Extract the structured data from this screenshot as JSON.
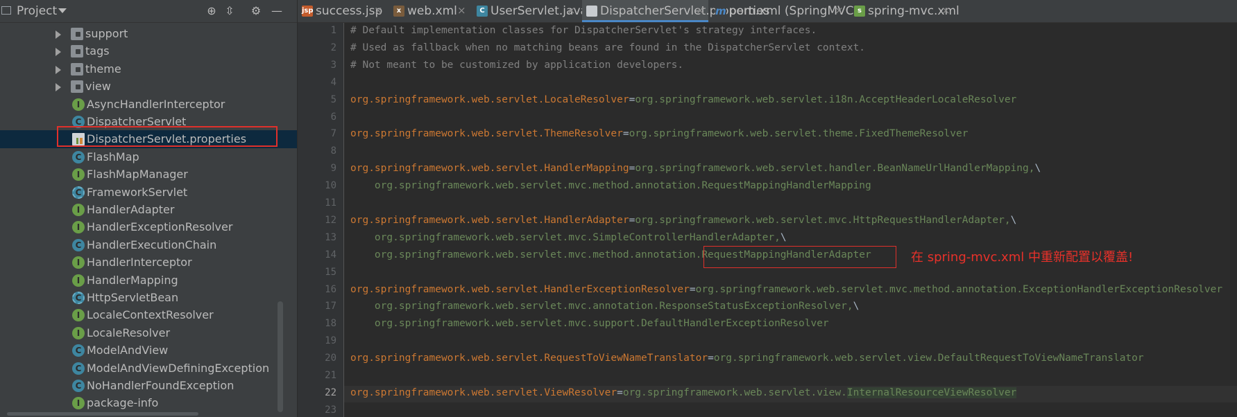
{
  "project_panel": {
    "title": "Project",
    "tree": [
      {
        "label": "support",
        "type": "folder"
      },
      {
        "label": "tags",
        "type": "folder"
      },
      {
        "label": "theme",
        "type": "folder"
      },
      {
        "label": "view",
        "type": "folder"
      },
      {
        "label": "AsyncHandlerInterceptor",
        "type": "interface"
      },
      {
        "label": "DispatcherServlet",
        "type": "class"
      },
      {
        "label": "DispatcherServlet.properties",
        "type": "properties",
        "selected": true
      },
      {
        "label": "FlashMap",
        "type": "class"
      },
      {
        "label": "FlashMapManager",
        "type": "interface"
      },
      {
        "label": "FrameworkServlet",
        "type": "abstract"
      },
      {
        "label": "HandlerAdapter",
        "type": "interface"
      },
      {
        "label": "HandlerExceptionResolver",
        "type": "interface"
      },
      {
        "label": "HandlerExecutionChain",
        "type": "class"
      },
      {
        "label": "HandlerInterceptor",
        "type": "interface"
      },
      {
        "label": "HandlerMapping",
        "type": "interface"
      },
      {
        "label": "HttpServletBean",
        "type": "abstract"
      },
      {
        "label": "LocaleContextResolver",
        "type": "interface"
      },
      {
        "label": "LocaleResolver",
        "type": "interface"
      },
      {
        "label": "ModelAndView",
        "type": "class"
      },
      {
        "label": "ModelAndViewDefiningException",
        "type": "class"
      },
      {
        "label": "NoHandlerFoundException",
        "type": "class"
      },
      {
        "label": "package-info",
        "type": "interface"
      }
    ]
  },
  "tabs": [
    {
      "label": "success.jsp",
      "icon": "jsp-file-icon",
      "icon_text": "jsp",
      "icon_color": "#c45c2c",
      "active": false
    },
    {
      "label": "web.xml",
      "icon": "xml-file-icon",
      "icon_text": "x",
      "icon_color": "#7a5c3c",
      "active": false
    },
    {
      "label": "UserServlet.java",
      "icon": "java-class-icon",
      "icon_text": "C",
      "icon_color": "#3e86a0",
      "active": false
    },
    {
      "label": "DispatcherServlet.properties",
      "icon": "properties-file-icon",
      "icon_text": "",
      "icon_color": "#c8ccd0",
      "active": true
    },
    {
      "label": "pom.xml (SpringMVC)",
      "icon": "maven-icon",
      "icon_text": "m",
      "icon_color": "#3c3f41",
      "active": false
    },
    {
      "label": "spring-mvc.xml",
      "icon": "spring-xml-icon",
      "icon_text": "s",
      "icon_color": "#6a9e48",
      "active": false
    }
  ],
  "editor": {
    "current_line": 22,
    "lines": [
      {
        "n": "1",
        "parts": [
          {
            "t": "# Default implementation classes for DispatcherServlet's strategy interfaces.",
            "c": "cmt"
          }
        ]
      },
      {
        "n": "2",
        "parts": [
          {
            "t": "# Used as fallback when no matching beans are found in the DispatcherServlet context.",
            "c": "cmt"
          }
        ]
      },
      {
        "n": "3",
        "parts": [
          {
            "t": "# Not meant to be customized by application developers.",
            "c": "cmt"
          }
        ]
      },
      {
        "n": "4",
        "parts": []
      },
      {
        "n": "5",
        "parts": [
          {
            "t": "org.springframework.web.servlet.LocaleResolver",
            "c": "key"
          },
          {
            "t": "=",
            "c": "sep"
          },
          {
            "t": "org.springframework.web.servlet.i18n.AcceptHeaderLocaleResolver",
            "c": "val"
          }
        ]
      },
      {
        "n": "6",
        "parts": []
      },
      {
        "n": "7",
        "parts": [
          {
            "t": "org.springframework.web.servlet.ThemeResolver",
            "c": "key"
          },
          {
            "t": "=",
            "c": "sep"
          },
          {
            "t": "org.springframework.web.servlet.theme.FixedThemeResolver",
            "c": "val"
          }
        ]
      },
      {
        "n": "8",
        "parts": []
      },
      {
        "n": "9",
        "parts": [
          {
            "t": "org.springframework.web.servlet.HandlerMapping",
            "c": "key"
          },
          {
            "t": "=",
            "c": "sep"
          },
          {
            "t": "org.springframework.web.servlet.handler.BeanNameUrlHandlerMapping,",
            "c": "val"
          },
          {
            "t": "\\",
            "c": "sep"
          }
        ]
      },
      {
        "n": "10",
        "parts": [
          {
            "t": "    org.springframework.web.servlet.mvc.method.annotation.RequestMappingHandlerMapping",
            "c": "val"
          }
        ]
      },
      {
        "n": "11",
        "parts": []
      },
      {
        "n": "12",
        "parts": [
          {
            "t": "org.springframework.web.servlet.HandlerAdapter",
            "c": "key"
          },
          {
            "t": "=",
            "c": "sep"
          },
          {
            "t": "org.springframework.web.servlet.mvc.HttpRequestHandlerAdapter,",
            "c": "val"
          },
          {
            "t": "\\",
            "c": "sep"
          }
        ]
      },
      {
        "n": "13",
        "parts": [
          {
            "t": "    org.springframework.web.servlet.mvc.SimpleControllerHandlerAdapter,",
            "c": "val"
          },
          {
            "t": "\\",
            "c": "sep"
          }
        ]
      },
      {
        "n": "14",
        "parts": [
          {
            "t": "    org.springframework.web.servlet.mvc.method.annotation.RequestMappingHandlerAdapter",
            "c": "val"
          }
        ]
      },
      {
        "n": "15",
        "parts": []
      },
      {
        "n": "16",
        "parts": [
          {
            "t": "org.springframework.web.servlet.HandlerExceptionResolver",
            "c": "key"
          },
          {
            "t": "=",
            "c": "sep"
          },
          {
            "t": "org.springframework.web.servlet.mvc.method.annotation.ExceptionHandlerExceptionResolver",
            "c": "val"
          }
        ]
      },
      {
        "n": "17",
        "parts": [
          {
            "t": "    org.springframework.web.servlet.mvc.annotation.ResponseStatusExceptionResolver,",
            "c": "val"
          },
          {
            "t": "\\",
            "c": "sep"
          }
        ]
      },
      {
        "n": "18",
        "parts": [
          {
            "t": "    org.springframework.web.servlet.mvc.support.DefaultHandlerExceptionResolver",
            "c": "val"
          }
        ]
      },
      {
        "n": "19",
        "parts": []
      },
      {
        "n": "20",
        "parts": [
          {
            "t": "org.springframework.web.servlet.RequestToViewNameTranslator",
            "c": "key"
          },
          {
            "t": "=",
            "c": "sep"
          },
          {
            "t": "org.springframework.web.servlet.view.DefaultRequestToViewNameTranslator",
            "c": "val"
          }
        ]
      },
      {
        "n": "21",
        "parts": []
      },
      {
        "n": "22",
        "parts": [
          {
            "t": "org.springframework.web.servlet.ViewResolver",
            "c": "key"
          },
          {
            "t": "=",
            "c": "sep"
          },
          {
            "t": "org.springframework.web.servlet.view.",
            "c": "val"
          },
          {
            "t": "InternalResourceViewResolver",
            "c": "hl"
          }
        ]
      },
      {
        "n": "23",
        "parts": []
      }
    ]
  },
  "annotation": {
    "text": "在 spring-mvc.xml 中重新配置以覆盖!",
    "color": "#e8312a"
  },
  "colors": {
    "comment": "#808080",
    "property_key": "#cc7832",
    "property_value": "#6a8759",
    "highlight_box": "#e0302b",
    "selection": "#0d293e"
  }
}
